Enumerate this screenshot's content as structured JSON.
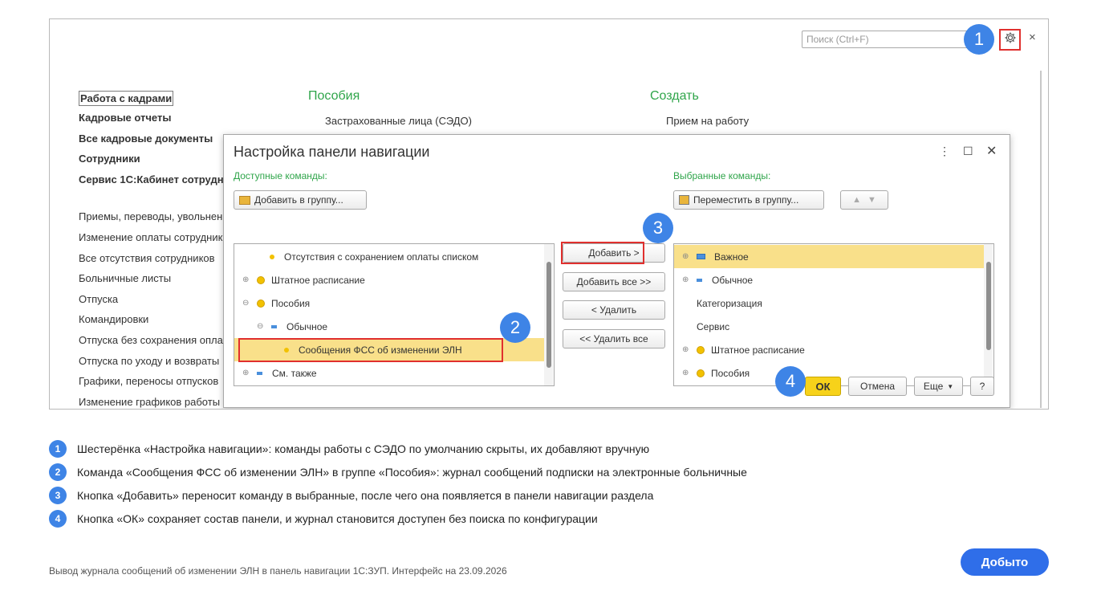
{
  "screenshot": {
    "search_placeholder": "Поиск (Ctrl+F)",
    "icons": {
      "settings": "gear-icon",
      "close": "close-icon"
    },
    "left_nav": [
      {
        "label": "Работа с кадрами",
        "bold": true
      },
      {
        "label": "Кадровые отчеты",
        "bold": true
      },
      {
        "label": "Все кадровые документы",
        "bold": true
      },
      {
        "label": "Сотрудники",
        "bold": true
      },
      {
        "label": "Сервис 1С:Кабинет сотрудн",
        "bold": true
      },
      {
        "label": "Приемы, переводы, увольнен"
      },
      {
        "label": "Изменение оплаты сотрудник"
      },
      {
        "label": "Все отсутствия сотрудников"
      },
      {
        "label": "Больничные листы"
      },
      {
        "label": "Отпуска"
      },
      {
        "label": "Командировки"
      },
      {
        "label": "Отпуска без сохранения опла"
      },
      {
        "label": "Отпуска по уходу и возвраты"
      },
      {
        "label": "Графики, переносы отпусков"
      },
      {
        "label": "Изменение графиков работы с"
      }
    ],
    "section_benefits": "Пособия",
    "section_create": "Создать",
    "benefits_item": "Застрахованные лица (СЭДО)",
    "create_item": "Прием на работу"
  },
  "dialog": {
    "title": "Настройка панели навигации",
    "available_label": "Доступные команды:",
    "selected_label": "Выбранные команды:",
    "add_to_group": "Добавить в группу...",
    "move_to_group": "Переместить в группу...",
    "available": [
      {
        "label": "Отсутствия с сохранением оплаты списком",
        "icon": "small-dot"
      },
      {
        "label": "Штатное расписание",
        "icon": "yellow-circle",
        "exp": "⊕"
      },
      {
        "label": "Пособия",
        "icon": "yellow-circle",
        "exp": "⊖"
      },
      {
        "label": "Обычное",
        "icon": "blue-dash",
        "exp": "⊖"
      },
      {
        "label": "Сообщения ФСС об изменении ЭЛН",
        "icon": "small-dot"
      },
      {
        "label": "См. также",
        "icon": "blue-dash",
        "exp": "⊕"
      }
    ],
    "selected": [
      {
        "label": "Важное",
        "icon": "blue-rect",
        "exp": "⊕"
      },
      {
        "label": "Обычное",
        "icon": "blue-dash",
        "exp": "⊕"
      },
      {
        "label": "Категоризация"
      },
      {
        "label": "Сервис"
      },
      {
        "label": "Штатное расписание",
        "icon": "yellow-circle",
        "exp": "⊕"
      },
      {
        "label": "Пособия",
        "icon": "yellow-circle",
        "exp": "⊕"
      }
    ],
    "buttons": {
      "add": "Добавить >",
      "add_all": "Добавить все >>",
      "remove": "< Удалить",
      "remove_all": "<< Удалить все",
      "ok": "ОК",
      "cancel": "Отмена",
      "more": "Еще",
      "help": "?"
    }
  },
  "callouts": [
    "1",
    "2",
    "3",
    "4"
  ],
  "notes": [
    {
      "num": "1",
      "text": "Шестерёнка «Настройка навигации»: команды работы с СЭДО по умолчанию скрыты, их добавляют вручную"
    },
    {
      "num": "2",
      "text": "Команда «Сообщения ФСС об изменении ЭЛН» в группе «Пособия»: журнал сообщений подписки на электронные больничные"
    },
    {
      "num": "3",
      "text": "Кнопка «Добавить» переносит команду в выбранные, после чего она появляется в панели навигации раздела"
    },
    {
      "num": "4",
      "text": "Кнопка «ОК» сохраняет состав панели, и журнал становится доступен без поиска по конфигурации"
    }
  ],
  "footer": "Вывод журнала сообщений об изменении ЭЛН в панель навигации 1С:ЗУП. Интерфейс на 23.09.2026",
  "done_button": "Добыто",
  "colors": {
    "accent_blue": "#3e84e6",
    "highlight_red": "#e0302e",
    "ok_yellow": "#f7d21a",
    "section_green": "#2fa54a",
    "done_blue": "#2f6ee9"
  }
}
